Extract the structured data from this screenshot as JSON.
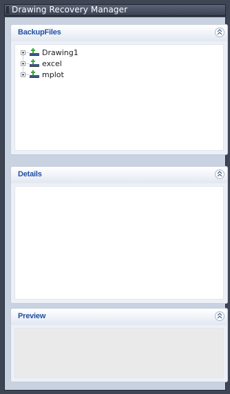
{
  "window": {
    "title": "Drawing Recovery Manager"
  },
  "sections": {
    "backup": {
      "label": "BackupFiles",
      "items": [
        {
          "label": "Drawing1",
          "icon": "network-drawing-icon"
        },
        {
          "label": "excel",
          "icon": "network-drawing-icon"
        },
        {
          "label": "mplot",
          "icon": "network-drawing-icon"
        }
      ]
    },
    "details": {
      "label": "Details"
    },
    "preview": {
      "label": "Preview"
    }
  },
  "colors": {
    "section_label": "#1f4fa3",
    "title_bar": "#3a4252",
    "panel_bg": "#c9d2e0"
  }
}
